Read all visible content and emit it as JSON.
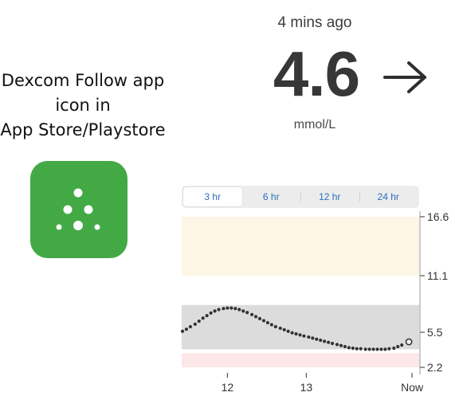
{
  "caption": {
    "line1": "Dexcom Follow app",
    "line2": "icon in",
    "line3": "App Store/Playstore"
  },
  "app_icon": {
    "icon": "dexcom-dots-logo",
    "color": "#43a945"
  },
  "reading": {
    "time_ago": "4 mins ago",
    "value": "4.6",
    "unit": "mmol/L",
    "trend_icon": "arrow-right-icon"
  },
  "tabs": [
    {
      "label": "3 hr",
      "active": true
    },
    {
      "label": "6 hr",
      "active": false
    },
    {
      "label": "12 hr",
      "active": false
    },
    {
      "label": "24 hr",
      "active": false
    }
  ],
  "chart_data": {
    "type": "scatter",
    "title": "",
    "xlabel": "",
    "ylabel": "",
    "x_ticks": [
      {
        "label": "12",
        "hour": 12
      },
      {
        "label": "13",
        "hour": 13
      },
      {
        "label": "Now",
        "hour": 14.34
      }
    ],
    "xlim": [
      11.42,
      14.43
    ],
    "y_ticks": [
      16.6,
      11.1,
      5.5,
      2.2
    ],
    "bands": [
      {
        "name": "high",
        "from": 11.1,
        "to": 16.6,
        "color": "#fdf6e6"
      },
      {
        "name": "target",
        "from": 3.9,
        "to": 11.1,
        "color": "#ffffff"
      },
      {
        "name": "in-range",
        "from": 3.9,
        "to": 8.2,
        "color": "#dcdcdc"
      },
      {
        "name": "low",
        "from": 2.2,
        "to": 3.6,
        "color": "#fde6e6"
      }
    ],
    "series": [
      {
        "marker_color": "#333333",
        "points": [
          [
            11.43,
            5.6
          ],
          [
            11.48,
            5.8
          ],
          [
            11.53,
            6.05
          ],
          [
            11.59,
            6.3
          ],
          [
            11.64,
            6.6
          ],
          [
            11.69,
            6.9
          ],
          [
            11.74,
            7.15
          ],
          [
            11.79,
            7.4
          ],
          [
            11.84,
            7.6
          ],
          [
            11.89,
            7.75
          ],
          [
            11.95,
            7.85
          ],
          [
            12.0,
            7.9
          ],
          [
            12.05,
            7.9
          ],
          [
            12.1,
            7.85
          ],
          [
            12.15,
            7.75
          ],
          [
            12.2,
            7.6
          ],
          [
            12.25,
            7.45
          ],
          [
            12.31,
            7.25
          ],
          [
            12.36,
            7.05
          ],
          [
            12.41,
            6.85
          ],
          [
            12.46,
            6.65
          ],
          [
            12.51,
            6.45
          ],
          [
            12.56,
            6.25
          ],
          [
            12.61,
            6.05
          ],
          [
            12.67,
            5.9
          ],
          [
            12.72,
            5.75
          ],
          [
            12.77,
            5.6
          ],
          [
            12.82,
            5.45
          ],
          [
            12.87,
            5.35
          ],
          [
            12.92,
            5.25
          ],
          [
            12.97,
            5.15
          ],
          [
            13.03,
            5.05
          ],
          [
            13.08,
            4.95
          ],
          [
            13.13,
            4.85
          ],
          [
            13.18,
            4.75
          ],
          [
            13.23,
            4.65
          ],
          [
            13.28,
            4.55
          ],
          [
            13.33,
            4.45
          ],
          [
            13.39,
            4.35
          ],
          [
            13.44,
            4.25
          ],
          [
            13.49,
            4.15
          ],
          [
            13.54,
            4.05
          ],
          [
            13.59,
            4.0
          ],
          [
            13.64,
            3.95
          ],
          [
            13.69,
            3.95
          ],
          [
            13.75,
            3.9
          ],
          [
            13.8,
            3.9
          ],
          [
            13.85,
            3.9
          ],
          [
            13.9,
            3.9
          ],
          [
            13.95,
            3.9
          ],
          [
            14.0,
            3.9
          ],
          [
            14.05,
            3.95
          ],
          [
            14.11,
            4.0
          ],
          [
            14.16,
            4.15
          ],
          [
            14.21,
            4.3
          ]
        ],
        "current": [
          14.3,
          4.6
        ]
      }
    ]
  }
}
